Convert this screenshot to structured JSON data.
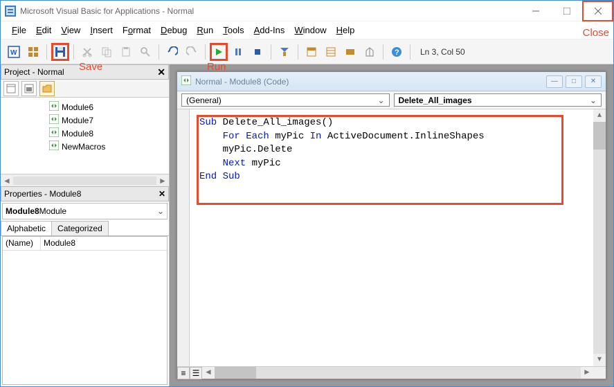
{
  "titlebar": {
    "title": "Microsoft Visual Basic for Applications - Normal"
  },
  "annotations": {
    "close": "Close",
    "save": "Save",
    "run": "Run"
  },
  "menu": {
    "file": "File",
    "edit": "Edit",
    "view": "View",
    "insert": "Insert",
    "format": "Format",
    "debug": "Debug",
    "run": "Run",
    "tools": "Tools",
    "addins": "Add-Ins",
    "window": "Window",
    "help": "Help"
  },
  "toolbar_status": "Ln 3, Col 50",
  "project_panel": {
    "title": "Project - Normal",
    "items": [
      "Module6",
      "Module7",
      "Module8",
      "NewMacros"
    ]
  },
  "properties_panel": {
    "title": "Properties - Module8",
    "object_name": "Module8",
    "object_type": " Module",
    "tabs": {
      "alphabetic": "Alphabetic",
      "categorized": "Categorized"
    },
    "row": {
      "key": "(Name)",
      "value": "Module8"
    }
  },
  "code_window": {
    "title": "Normal - Module8 (Code)",
    "left_combo": "(General)",
    "right_combo": "Delete_All_images",
    "code": {
      "l1": {
        "a": "Sub",
        "b": " Delete_All_images()"
      },
      "l2": {
        "a": "    For",
        "b": " Each",
        "c": " myPic ",
        "d": "In",
        "e": " ActiveDocument.InlineShapes"
      },
      "l3": {
        "a": "    myPic.Delete"
      },
      "l4": {
        "a": "    Next",
        "b": " myPic"
      },
      "l5": {
        "a": "End",
        "b": " Sub"
      }
    }
  }
}
